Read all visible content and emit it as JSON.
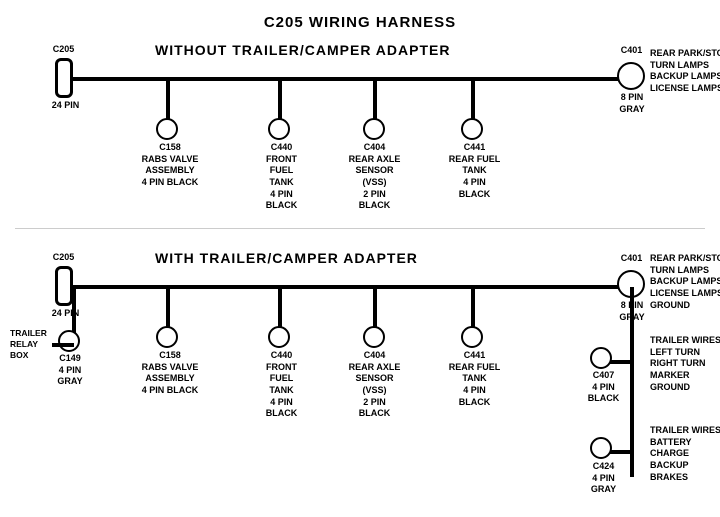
{
  "title": "C205 WIRING HARNESS",
  "section1": {
    "label": "WITHOUT  TRAILER/CAMPER ADAPTER",
    "connectors": [
      {
        "id": "C205_1",
        "label": "C205",
        "sublabel": "24 PIN",
        "type": "rect"
      },
      {
        "id": "C401_1",
        "label": "C401",
        "sublabel": "8 PIN\nGRAY",
        "type": "circle"
      },
      {
        "id": "C158_1",
        "label": "C158",
        "sublabel": "RABS VALVE\nASSEMBLY\n4 PIN BLACK"
      },
      {
        "id": "C440_1",
        "label": "C440",
        "sublabel": "FRONT FUEL\nTANK\n4 PIN BLACK"
      },
      {
        "id": "C404_1",
        "label": "C404",
        "sublabel": "REAR AXLE\nSENSOR\n(VSS)\n2 PIN BLACK"
      },
      {
        "id": "C441_1",
        "label": "C441",
        "sublabel": "REAR FUEL\nTANK\n4 PIN BLACK"
      }
    ],
    "right_label": "REAR PARK/STOP\nTURN LAMPS\nBACKUP LAMPS\nLICENSE LAMPS"
  },
  "section2": {
    "label": "WITH TRAILER/CAMPER ADAPTER",
    "connectors": [
      {
        "id": "C205_2",
        "label": "C205",
        "sublabel": "24 PIN",
        "type": "rect"
      },
      {
        "id": "C401_2",
        "label": "C401",
        "sublabel": "8 PIN\nGRAY",
        "type": "circle"
      },
      {
        "id": "C158_2",
        "label": "C158",
        "sublabel": "RABS VALVE\nASSEMBLY\n4 PIN BLACK"
      },
      {
        "id": "C440_2",
        "label": "C440",
        "sublabel": "FRONT FUEL\nTANK\n4 PIN BLACK"
      },
      {
        "id": "C404_2",
        "label": "C404",
        "sublabel": "REAR AXLE\nSENSOR\n(VSS)\n2 PIN BLACK"
      },
      {
        "id": "C441_2",
        "label": "C441",
        "sublabel": "REAR FUEL\nTANK\n4 PIN BLACK"
      },
      {
        "id": "C149",
        "label": "C149",
        "sublabel": "4 PIN GRAY"
      },
      {
        "id": "C407",
        "label": "C407",
        "sublabel": "4 PIN\nBLACK"
      },
      {
        "id": "C424",
        "label": "C424",
        "sublabel": "4 PIN\nGRAY"
      }
    ],
    "right_label1": "REAR PARK/STOP\nTURN LAMPS\nBACKUP LAMPS\nLICENSE LAMPS\nGROUND",
    "right_label2": "TRAILER WIRES\nLEFT TURN\nRIGHT TURN\nMARKER\nGROUND",
    "right_label3": "TRAILER WIRES\nBATTERY CHARGE\nBACKUP\nBRAKES",
    "left_label": "TRAILER\nRELAY\nBOX"
  }
}
